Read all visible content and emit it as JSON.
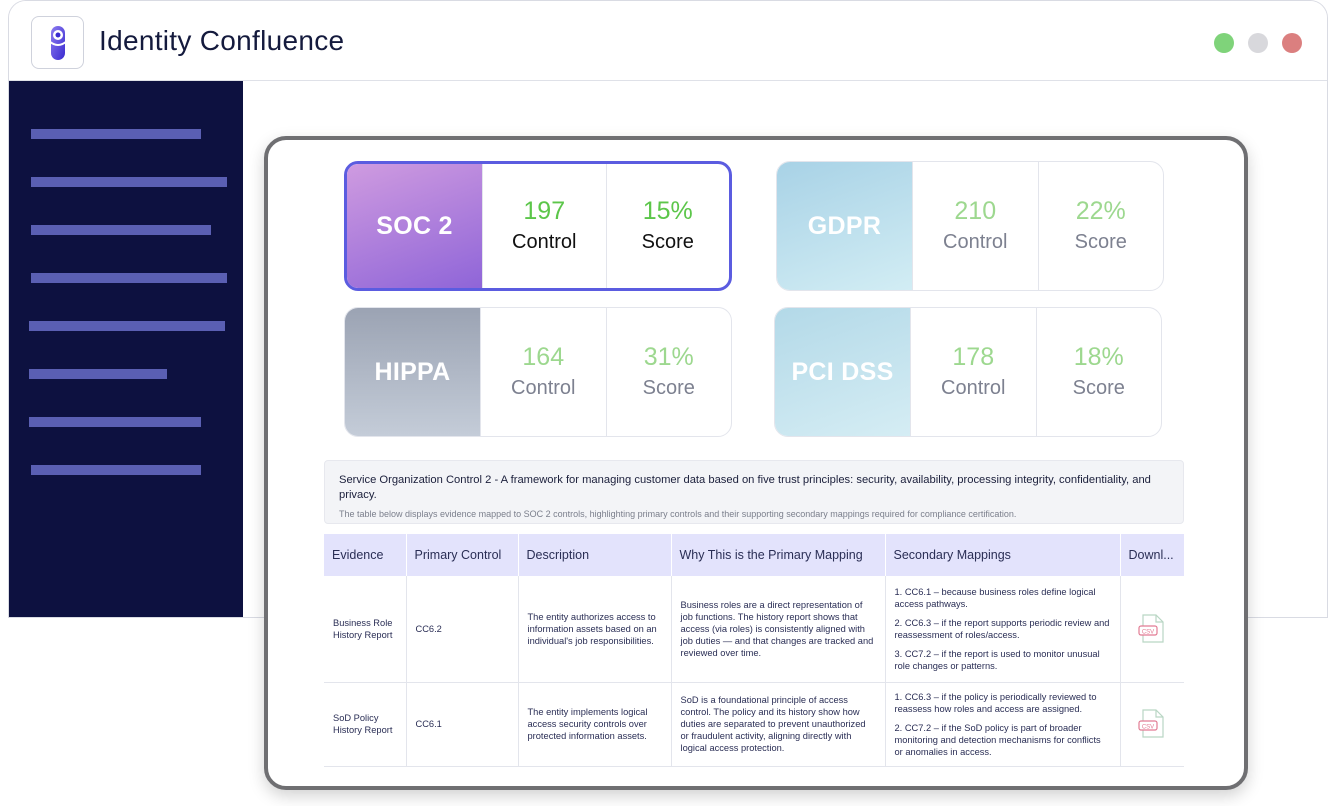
{
  "app": {
    "title": "Identity Confluence",
    "window_controls": [
      {
        "name": "maximize",
        "color": "#7fd37a"
      },
      {
        "name": "minimize",
        "color": "#d8d8dc"
      },
      {
        "name": "close",
        "color": "#db7f7f"
      }
    ]
  },
  "sidebar": {
    "item_count": 8
  },
  "frameworks": [
    {
      "name": "SOC 2",
      "control_value": "197",
      "control_label": "Control",
      "score_value": "15%",
      "score_label": "Score",
      "selected": true
    },
    {
      "name": "GDPR",
      "control_value": "210",
      "control_label": "Control",
      "score_value": "22%",
      "score_label": "Score",
      "selected": false
    },
    {
      "name": "HIPPA",
      "control_value": "164",
      "control_label": "Control",
      "score_value": "31%",
      "score_label": "Score",
      "selected": false
    },
    {
      "name": "PCI DSS",
      "control_value": "178",
      "control_label": "Control",
      "score_value": "18%",
      "score_label": "Score",
      "selected": false
    }
  ],
  "info": {
    "title": "Service Organization Control 2 - A framework for managing customer data based on five trust principles: security, availability, processing integrity, confidentiality, and privacy.",
    "subtitle": "The table below displays evidence mapped to SOC 2 controls, highlighting primary controls and their supporting secondary mappings required for compliance certification."
  },
  "table": {
    "headers": [
      "Evidence",
      "Primary Control",
      "Description",
      "Why This is the Primary Mapping",
      "Secondary Mappings",
      "Downl..."
    ],
    "rows": [
      {
        "evidence": "Business Role History Report",
        "primary_control": "CC6.2",
        "description": "The entity authorizes access to information assets based on an individual's job responsibilities.",
        "why": "Business roles are a direct representation of job functions. The history report shows that access (via roles) is consistently aligned with job duties — and that changes are tracked and reviewed over time.",
        "secondary": [
          "1. CC6.1 – because business roles define logical access pathways.",
          "2. CC6.3 – if the report supports periodic review and reassessment of roles/access.",
          "3. CC7.2 – if the report is used to monitor unusual role changes or patterns."
        ],
        "download": "CSV"
      },
      {
        "evidence": "SoD Policy History Report",
        "primary_control": "CC6.1",
        "description": "The entity implements logical access security controls over protected information assets.",
        "why": "SoD is a foundational principle of access control. The policy and its history show how duties are separated to prevent unauthorized or fraudulent activity, aligning directly with logical access protection.",
        "secondary": [
          "1. CC6.3 – if the policy is periodically reviewed to reassess how roles and access are assigned.",
          "2. CC7.2 – if the SoD policy is part of broader monitoring and detection mechanisms for conflicts or anomalies in access."
        ],
        "download": "CSV"
      }
    ]
  },
  "colors": {
    "sidebar_bg": "#0d1140",
    "sidebar_bar": "#5a5fb3",
    "accent": "#5b5ce0",
    "metric_green": "#5cc64a",
    "table_header_bg": "#e3e3fc"
  }
}
